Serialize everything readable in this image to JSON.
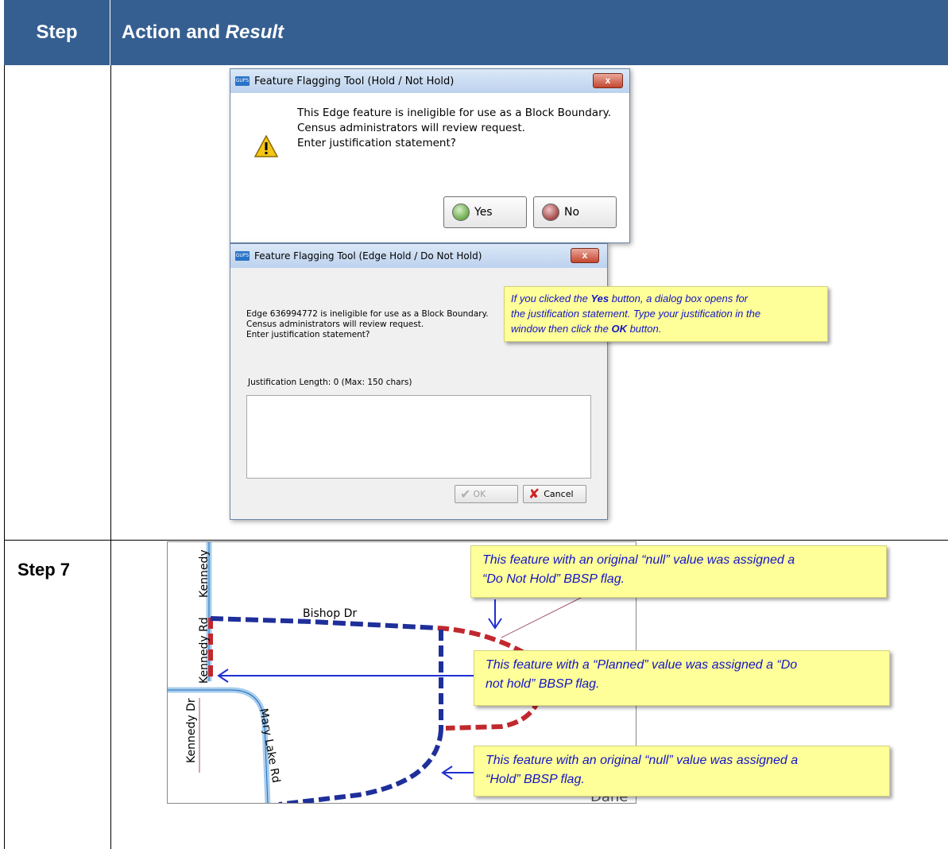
{
  "header": {
    "step_label": "Step",
    "action_label": "Action and",
    "result_label": "Result"
  },
  "row2": {
    "step_label": "Step 7"
  },
  "dialog1": {
    "title": "Feature Flagging Tool (Hold / Not Hold)",
    "close": "x",
    "lines": [
      "This Edge feature is ineligible for use as a Block Boundary.",
      "Census administrators will review request.",
      "Enter justification statement?"
    ],
    "yes_label": "Yes",
    "no_label": "No"
  },
  "dialog2": {
    "title": "Feature Flagging Tool (Edge Hold / Do Not Hold)",
    "close": "x",
    "lines": [
      "Edge 636994772 is ineligible for use as a Block Boundary.",
      "Census administrators will review request.",
      "Enter justification statement?"
    ],
    "length_label": "Justification Length: 0 (Max: 150 chars)",
    "textarea_value": "",
    "ok_label": "OK",
    "cancel_label": "Cancel"
  },
  "callout_yes": {
    "p1": "If you clicked the ",
    "p1_bold": "Yes",
    "p2": " button, a dialog box opens for",
    "line2": "the justification statement. Type your justification in the",
    "p3": "window then click the ",
    "p3_bold": "OK",
    "p4": " button."
  },
  "map": {
    "labels": {
      "kennedy_top": "Kennedy",
      "bishop": "Bishop Dr",
      "kennedy_rd": "Kennedy Rd",
      "kennedy_dr": "Kennedy Dr",
      "mary_lake": "Mary Lake Rd",
      "dane": "Dane"
    },
    "callouts": [
      {
        "line1": "This feature with an original “null” value was assigned a",
        "line2": "“Do Not Hold” BBSP flag."
      },
      {
        "line1": "This feature with a “Planned” value was assigned a “Do",
        "line2": "not hold” BBSP flag."
      },
      {
        "line1": "This feature with an original “null” value was assigned a",
        "line2": "“Hold” BBSP flag."
      }
    ]
  },
  "colors": {
    "header_bg": "#365f91",
    "callout_bg": "#ffff99",
    "callout_text": "#1414c8",
    "hold_blue": "#1f2f9a",
    "nohold_red": "#c0282e"
  }
}
